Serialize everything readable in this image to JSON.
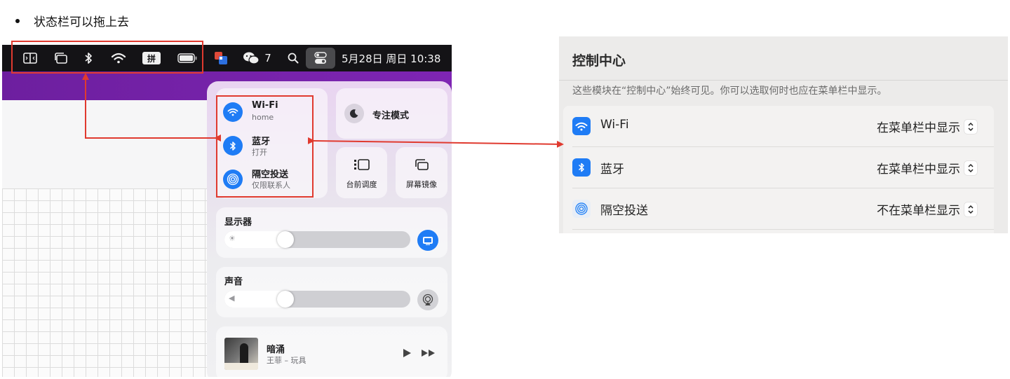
{
  "heading": "状态栏可以拖上去",
  "menubar": {
    "wechat_count": "7",
    "datetime": "5月28日 周日  10:38",
    "ime_label": "拼"
  },
  "control_center": {
    "wifi": {
      "title": "Wi-Fi",
      "subtitle": "home"
    },
    "bluetooth": {
      "title": "蓝牙",
      "subtitle": "打开"
    },
    "airdrop": {
      "title": "隔空投送",
      "subtitle": "仅限联系人"
    },
    "focus": {
      "title": "专注模式"
    },
    "stage_manager": {
      "label": "台前调度"
    },
    "screen_mirroring": {
      "label": "屏幕镜像"
    },
    "display": {
      "title": "显示器",
      "level": 0.33
    },
    "sound": {
      "title": "声音",
      "level": 0.33
    },
    "now_playing": {
      "title": "暗涌",
      "artist": "王菲 – 玩具"
    }
  },
  "settings": {
    "title": "控制中心",
    "description": "这些模块在“控制中心”始终可见。你可以选取何时也应在菜单栏中显示。",
    "rows": [
      {
        "label": "Wi-Fi",
        "value": "在菜单栏中显示"
      },
      {
        "label": "蓝牙",
        "value": "在菜单栏中显示"
      },
      {
        "label": "隔空投送",
        "value": "不在菜单栏显示"
      }
    ]
  },
  "colors": {
    "accent_blue": "#1f7cf5",
    "annotation_red": "#e03a2f",
    "menubar_bg": "#141316"
  }
}
